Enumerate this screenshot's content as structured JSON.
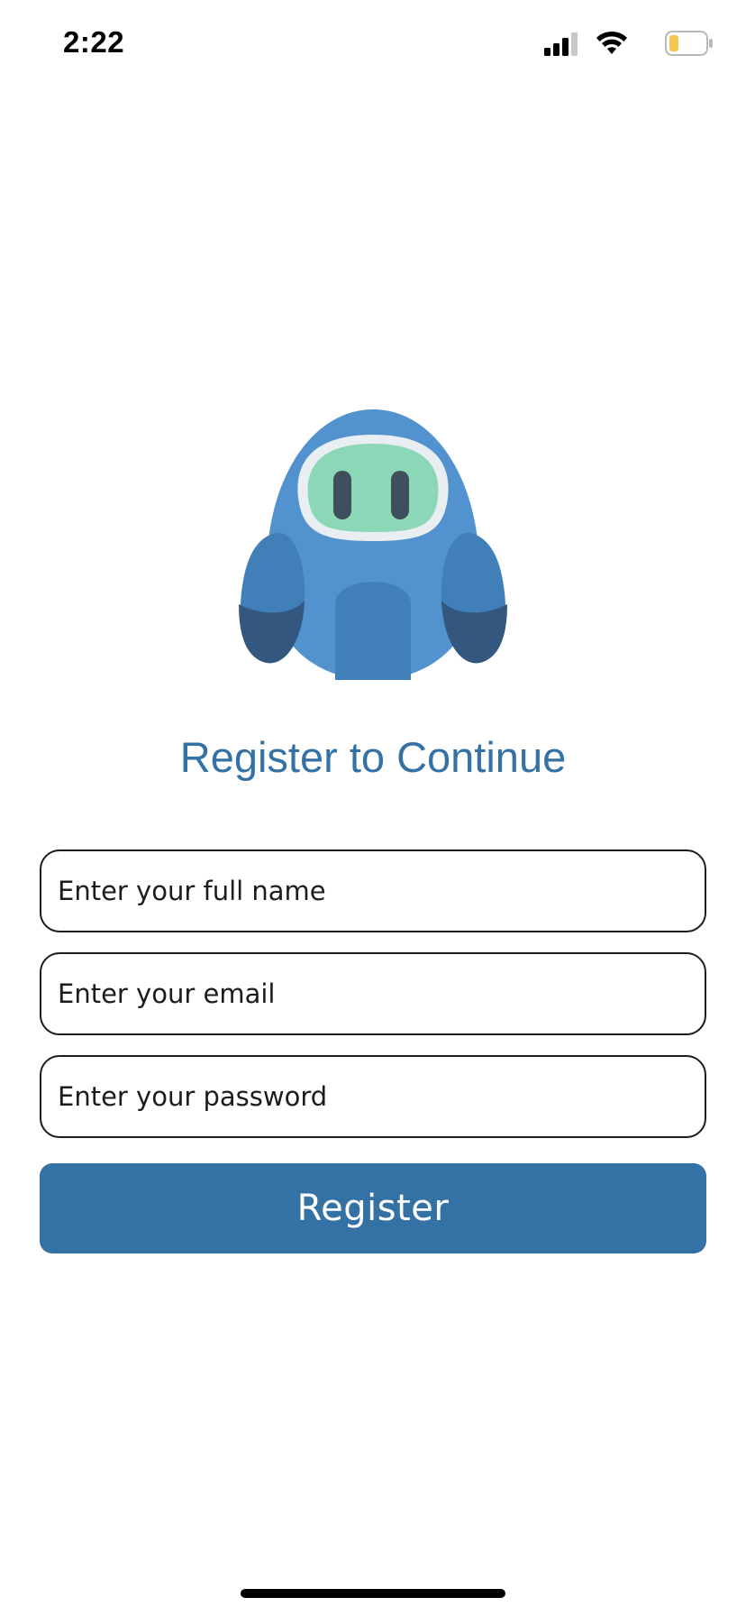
{
  "status_bar": {
    "time": "2:22",
    "signal_icon": "cellular-signal-icon",
    "wifi_icon": "wifi-icon",
    "battery_icon": "battery-low-icon",
    "battery_color": "#f2c94c"
  },
  "mascot": {
    "icon": "blue-robot-mascot",
    "body_color": "#5293cf",
    "visor_color": "#8bd7b8"
  },
  "title": "Register to Continue",
  "form": {
    "full_name": {
      "placeholder": "Enter your full name",
      "value": ""
    },
    "email": {
      "placeholder": "Enter your email",
      "value": ""
    },
    "password": {
      "placeholder": "Enter your password",
      "value": ""
    },
    "submit_label": "Register"
  },
  "colors": {
    "accent": "#3472a5",
    "border": "#1c1c1c"
  }
}
